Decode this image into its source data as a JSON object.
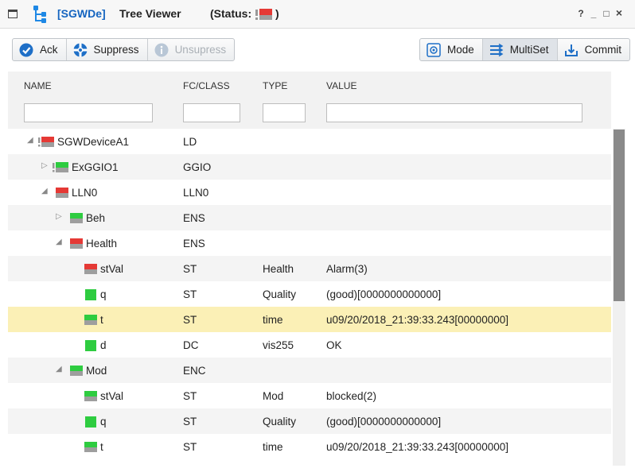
{
  "window": {
    "app_tag": "[SGWDe]",
    "title": "Tree Viewer",
    "status_label": "(Status:",
    "status_close": ")",
    "status_color": "#e53935",
    "controls": [
      "?",
      "_",
      "□",
      "×"
    ]
  },
  "toolbar": {
    "left": [
      {
        "label": "Ack",
        "icon": "check-circle-icon",
        "enabled": true
      },
      {
        "label": "Suppress",
        "icon": "lifebuoy-icon",
        "enabled": true
      },
      {
        "label": "Unsupress",
        "icon": "info-icon",
        "enabled": false
      }
    ],
    "right": [
      {
        "label": "Mode",
        "icon": "mode-icon",
        "active": false
      },
      {
        "label": "MultiSet",
        "icon": "multiset-icon",
        "active": true
      },
      {
        "label": "Commit",
        "icon": "commit-icon",
        "active": false
      }
    ]
  },
  "columns": {
    "name": "NAME",
    "fc": "FC/CLASS",
    "type": "TYPE",
    "value": "VALUE"
  },
  "filters": {
    "name": "",
    "fc": "",
    "type": "",
    "value": ""
  },
  "colors": {
    "accent": "#1565c0",
    "status_red": "#e53935",
    "status_green": "#2ecc40",
    "selected_row": "#fbf0b6"
  },
  "rows": [
    {
      "name": "SGWDeviceA1",
      "fc": "LD",
      "type": "",
      "value": "",
      "expander": "expanded",
      "icon": "red-bang"
    },
    {
      "name": "ExGGIO1",
      "fc": "GGIO",
      "type": "",
      "value": "",
      "expander": "collapsed",
      "icon": "green-bang"
    },
    {
      "name": "LLN0",
      "fc": "LLN0",
      "type": "",
      "value": "",
      "expander": "expanded",
      "icon": "red-bar"
    },
    {
      "name": "Beh",
      "fc": "ENS",
      "type": "",
      "value": "",
      "expander": "collapsed",
      "icon": "green-bar"
    },
    {
      "name": "Health",
      "fc": "ENS",
      "type": "",
      "value": "",
      "expander": "expanded",
      "icon": "red-bar"
    },
    {
      "name": "stVal",
      "fc": "ST",
      "type": "Health",
      "value": "Alarm(3)",
      "expander": "",
      "icon": "red-bar"
    },
    {
      "name": "q",
      "fc": "ST",
      "type": "Quality",
      "value": "(good)[0000000000000]",
      "expander": "",
      "icon": "green-square"
    },
    {
      "name": "t",
      "fc": "ST",
      "type": "time",
      "value": "u09/20/2018_21:39:33.243[00000000]",
      "expander": "",
      "icon": "green-bar",
      "selected": true
    },
    {
      "name": "d",
      "fc": "DC",
      "type": "vis255",
      "value": "OK",
      "expander": "",
      "icon": "green-square"
    },
    {
      "name": "Mod",
      "fc": "ENC",
      "type": "",
      "value": "",
      "expander": "expanded",
      "icon": "green-bar"
    },
    {
      "name": "stVal",
      "fc": "ST",
      "type": "Mod",
      "value": "blocked(2)",
      "expander": "",
      "icon": "green-bar"
    },
    {
      "name": "q",
      "fc": "ST",
      "type": "Quality",
      "value": "(good)[0000000000000]",
      "expander": "",
      "icon": "green-square"
    },
    {
      "name": "t",
      "fc": "ST",
      "type": "time",
      "value": "u09/20/2018_21:39:33.243[00000000]",
      "expander": "",
      "icon": "green-bar"
    }
  ]
}
